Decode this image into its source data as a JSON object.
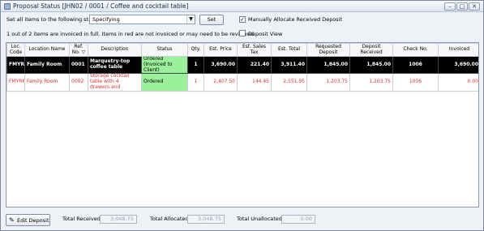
{
  "window": {
    "title": "Proposal Status [JHN02 / 0001 / Coffee and cocktail table]",
    "buttons": {
      "minimize": "–",
      "maximize": "□",
      "close": "✕"
    }
  },
  "status_bar": {
    "set_all_label": "Set all items to the following status",
    "status_selected": "Specifying",
    "set_button": "Set",
    "manual_allocate_label": "Manually Allocate Received Deposit",
    "manual_allocate_checked": true,
    "deposit_view_label": "Deposit View",
    "deposit_view_checked": false,
    "info_text": "1 out of 2 items are invoiced in full.  Items in red are not invoiced or may need to be reviewed."
  },
  "table": {
    "columns": [
      "Loc. Code",
      "Location Name",
      "Ref. No. ▽",
      "Description",
      "Status",
      "Qty.",
      "Est. Price",
      "Est. Sales Tax",
      "Est. Total",
      "Requested Deposit",
      "Deposit Received",
      "Check No.",
      "Invoiced"
    ],
    "rows": [
      {
        "loc_code": "FMYRM",
        "location": "Family Room",
        "ref": "0001",
        "description": "Marquetry-top coffee table",
        "status": "Ordered (Invoiced to Client)",
        "qty": "1",
        "price": "3,690.00",
        "tax": "221.40",
        "total": "3,911.40",
        "requested": "1,845.00",
        "received": "1,845.00",
        "check": "1006",
        "invoiced": "3,690.00"
      },
      {
        "loc_code": "FMYRM",
        "location": "Family Room",
        "ref": "0002",
        "description": "Storage cocktail table with 4 drawers and",
        "status": "Ordered",
        "qty": "1",
        "price": "2,407.50",
        "tax": "144.45",
        "total": "2,551.95",
        "requested": "1,203.75",
        "received": "1,203.75",
        "check": "1006",
        "invoiced": "0.00"
      }
    ]
  },
  "footer": {
    "edit_deposit_button": "Edit Deposit",
    "total_received_label": "Total Received",
    "total_received": "3,048.75",
    "total_allocated_label": "Total Allocated",
    "total_allocated": "3,048.75",
    "total_unallocated_label": "Total Unallocated",
    "total_unallocated": "0.00"
  }
}
